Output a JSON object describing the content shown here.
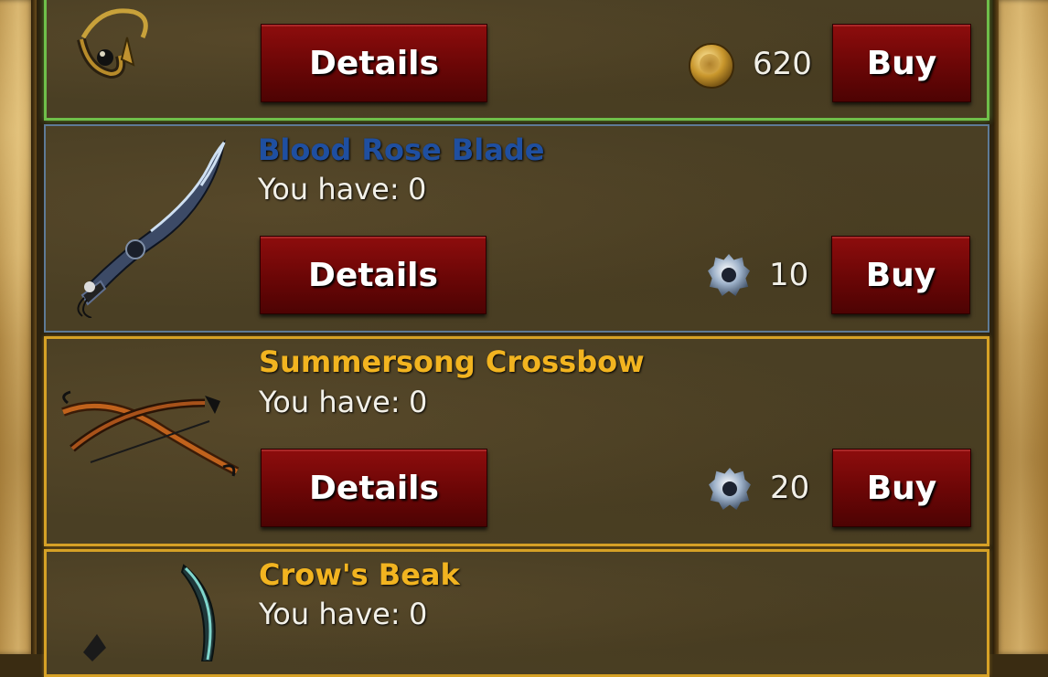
{
  "shop": {
    "items": [
      {
        "name": "",
        "have_label": "",
        "have_value": "",
        "details_label": "Details",
        "buy_label": "Buy",
        "price": "620",
        "currency_icon": "gold-coin-icon",
        "item_icon": "amulet-icon",
        "border_color": "#6fbf4a"
      },
      {
        "name": "Blood Rose Blade",
        "have_label": "You have:",
        "have_value": "0",
        "details_label": "Details",
        "buy_label": "Buy",
        "price": "10",
        "currency_icon": "gem-icon",
        "item_icon": "curved-sword-icon",
        "name_color": "#1f4fa0",
        "border_color": "#5e7a96"
      },
      {
        "name": "Summersong Crossbow",
        "have_label": "You have:",
        "have_value": "0",
        "details_label": "Details",
        "buy_label": "Buy",
        "price": "20",
        "currency_icon": "gem-icon",
        "item_icon": "crossbow-icon",
        "name_color": "#f2b420",
        "border_color": "#d6a126"
      },
      {
        "name": "Crow's Beak",
        "have_label": "You have:",
        "have_value": "0",
        "item_icon": "scythe-blade-icon",
        "name_color": "#f2b420",
        "border_color": "#d6a126"
      }
    ]
  }
}
